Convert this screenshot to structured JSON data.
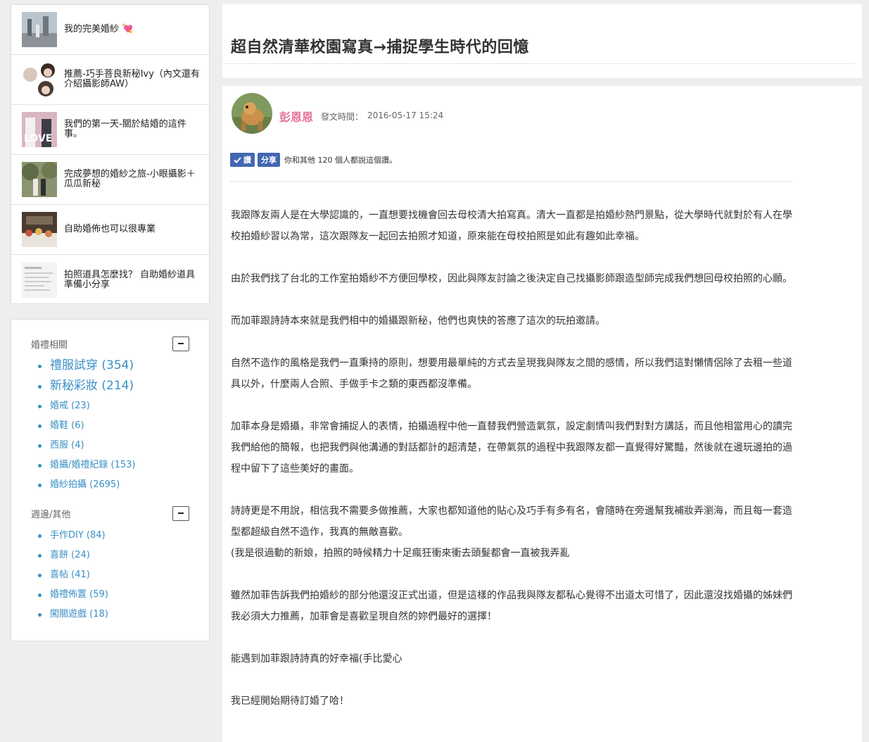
{
  "related_posts": [
    {
      "title": "我的完美婚紗 💘"
    },
    {
      "title": "推薦-巧手菩良新秘Ivy（內文還有介紹攝影師AW）"
    },
    {
      "title": "我們的第一天-關於結婚的這件事。"
    },
    {
      "title": "完成夢想的婚紗之旅-小眼攝影＋瓜瓜新秘"
    },
    {
      "title": "自助婚佈也可以很專業"
    },
    {
      "title": "拍照道具怎麼找？ 自助婚紗道具準備小分享"
    }
  ],
  "tag_groups": [
    {
      "title": "婚禮相關",
      "tags": [
        {
          "label": "禮服試穿 (354)"
        },
        {
          "label": "新秘彩妝 (214)"
        },
        {
          "label": "婚戒 (23)"
        },
        {
          "label": "婚鞋 (6)"
        },
        {
          "label": "西服 (4)"
        },
        {
          "label": "婚攝/婚禮紀錄 (153)"
        },
        {
          "label": "婚紗拍攝 (2695)"
        }
      ]
    },
    {
      "title": "週邊/其他",
      "tags": [
        {
          "label": "手作DIY (84)"
        },
        {
          "label": "喜餅 (24)"
        },
        {
          "label": "喜帖 (41)"
        },
        {
          "label": "婚禮佈置 (59)"
        },
        {
          "label": "闖關遊戲 (18)"
        }
      ]
    }
  ],
  "post": {
    "title": "超自然清華校園寫真→捕捉學生時代的回憶",
    "author": "彭恩恩",
    "date_label": "發文時間：",
    "date": "2016-05-17 15:24",
    "like_label": "讚",
    "share_label": "分享",
    "like_text": "你和其他 120 個人都說這個讚。",
    "paragraphs": [
      "我跟隊友兩人是在大學認識的，一直想要找機會回去母校清大拍寫真。清大一直都是拍婚紗熱門景點，從大學時代就對於有人在學校拍婚紗習以為常，這次跟隊友一起回去拍照才知道，原來能在母校拍照是如此有趣如此幸福。",
      "由於我們找了台北的工作室拍婚紗不方便回學校，因此與隊友討論之後決定自己找攝影師跟造型師完成我們想回母校拍照的心願。",
      "而加菲跟詩詩本來就是我們相中的婚攝跟新秘，他們也爽快的答應了這次的玩拍邀請。",
      "自然不造作的風格是我們一直秉持的原則，想要用最單純的方式去呈現我與隊友之間的感情，所以我們這對懶情侶除了去租一些道具以外，什麼兩人合照、手做手卡之類的東西都沒準備。",
      "加菲本身是婚攝，非常會捕捉人的表情，拍攝過程中他一直替我們營造氣氛，設定劇情叫我們對對方講話，而且他相當用心的讀完我們給他的簡報，也把我們與他溝通的對話都計的超清楚，在帶氣氛的過程中我跟隊友都一直覺得好驚豔，然後就在邊玩邊拍的過程中留下了這些美好的畫面。",
      "詩詩更是不用說，相信我不需要多做推薦，大家也都知道他的貼心及巧手有多有名，會隨時在旁邊幫我補妝弄瀏海，而且每一套造型都超級自然不造作，我真的無敵喜歡。\n(我是很過動的新娘，拍照的時候精力十足瘋狂衝來衝去頭髮都會一直被我弄亂",
      "雖然加菲告訴我們拍婚紗的部分他還沒正式出道，但是這樣的作品我與隊友都私心覺得不出道太可惜了，因此還沒找婚攝的姊妹們我必須大力推薦，加菲會是喜歡呈現自然的妳們最好的選擇！",
      "能遇到加菲跟詩詩真的好幸福(手比愛心",
      "我已經開始期待訂婚了哈！"
    ]
  },
  "colors": {
    "author": "#e6739a",
    "link": "#3a8fc4",
    "fb": "#4267b2"
  }
}
